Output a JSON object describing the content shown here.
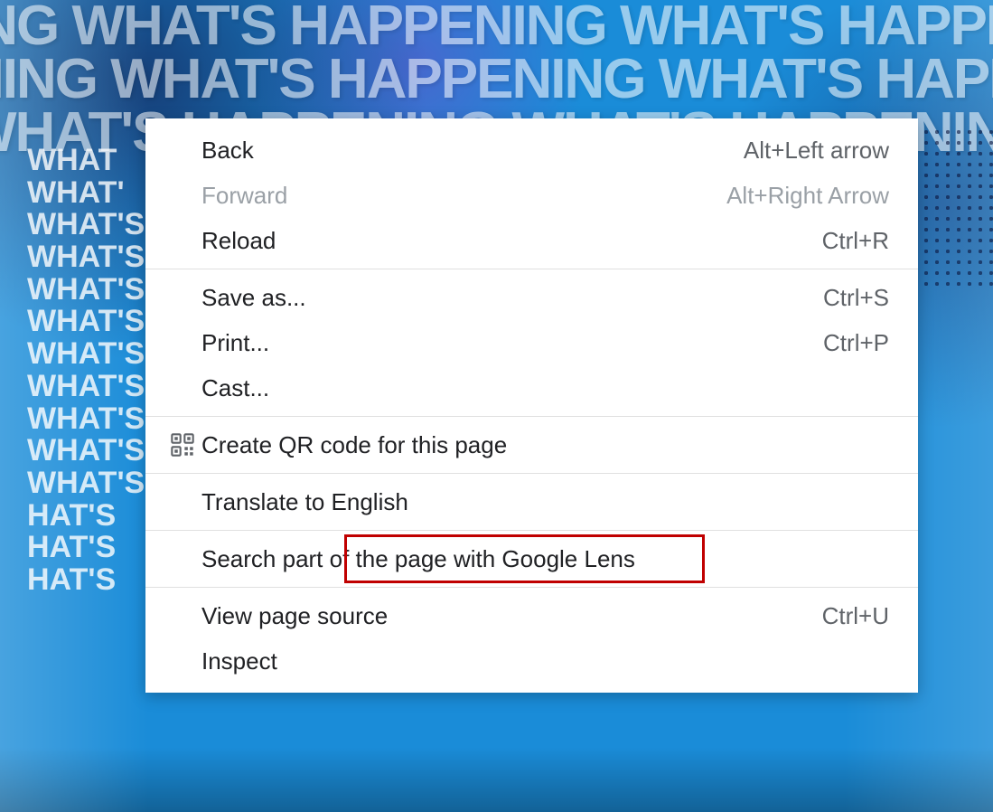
{
  "background": {
    "repeated_text": "WHAT'S HAPPENING",
    "left_text": "WHAT'S",
    "accent_color": "#1a8cd8"
  },
  "context_menu": {
    "items": [
      {
        "label": "Back",
        "shortcut": "Alt+Left arrow",
        "disabled": false
      },
      {
        "label": "Forward",
        "shortcut": "Alt+Right Arrow",
        "disabled": true
      },
      {
        "label": "Reload",
        "shortcut": "Ctrl+R",
        "disabled": false
      }
    ],
    "items2": [
      {
        "label": "Save as...",
        "shortcut": "Ctrl+S"
      },
      {
        "label": "Print...",
        "shortcut": "Ctrl+P"
      },
      {
        "label": "Cast..."
      }
    ],
    "qr_item": {
      "label": "Create QR code for this page"
    },
    "translate_item": {
      "label": "Translate to English"
    },
    "lens_item": {
      "label": "Search part of the page with Google Lens"
    },
    "items3": [
      {
        "label": "View page source",
        "shortcut": "Ctrl+U"
      },
      {
        "label": "Inspect"
      }
    ],
    "highlight_color": "#c00000"
  }
}
